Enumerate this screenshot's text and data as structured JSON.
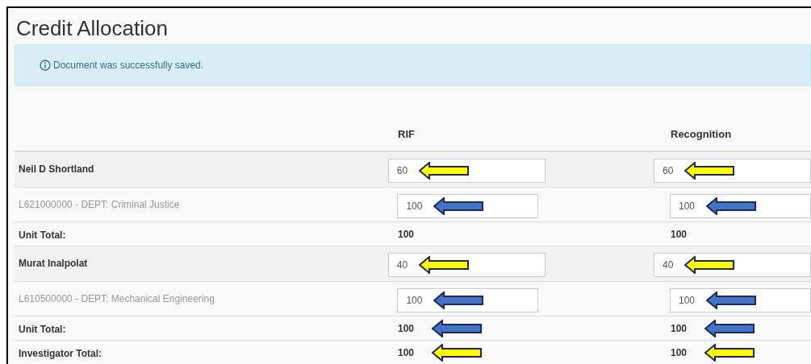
{
  "title": "Credit Allocation",
  "alert": {
    "text": "Document was successfully saved."
  },
  "table": {
    "columns": [
      "RIF",
      "Recognition"
    ],
    "rows": [
      {
        "kind": "person",
        "label": "Neil D Shortland",
        "cells": [
          {
            "kind": "input",
            "value": "60",
            "color": "#ffff00"
          },
          {
            "kind": "input",
            "value": "60",
            "color": "#ffff00"
          }
        ]
      },
      {
        "kind": "unit",
        "label": "L621000000 - DEPT: Criminal Justice",
        "cells": [
          {
            "kind": "input",
            "value": "100",
            "color": "#4472c4"
          },
          {
            "kind": "input",
            "value": "100",
            "color": "#4472c4"
          }
        ]
      },
      {
        "kind": "total",
        "label": "Unit Total:",
        "cells": [
          {
            "kind": "text",
            "value": "100"
          },
          {
            "kind": "text",
            "value": "100"
          }
        ]
      },
      {
        "kind": "person",
        "label": "Murat Inalpolat",
        "cells": [
          {
            "kind": "input",
            "value": "40",
            "color": "#ffff00"
          },
          {
            "kind": "input",
            "value": "40",
            "color": "#ffff00"
          }
        ]
      },
      {
        "kind": "unit",
        "label": "L610500000 - DEPT: Mechanical Engineering",
        "cells": [
          {
            "kind": "input",
            "value": "100",
            "color": "#4472c4"
          },
          {
            "kind": "input",
            "value": "100",
            "color": "#4472c4"
          }
        ]
      },
      {
        "kind": "total",
        "label": "Unit Total:",
        "cells": [
          {
            "kind": "text",
            "value": "100",
            "color": "#4472c4"
          },
          {
            "kind": "text",
            "value": "100",
            "color": "#4472c4"
          }
        ]
      },
      {
        "kind": "total",
        "label": "Investigator Total:",
        "cells": [
          {
            "kind": "text",
            "value": "100",
            "color": "#ffff00"
          },
          {
            "kind": "text",
            "value": "100",
            "color": "#ffff00"
          }
        ]
      }
    ]
  }
}
